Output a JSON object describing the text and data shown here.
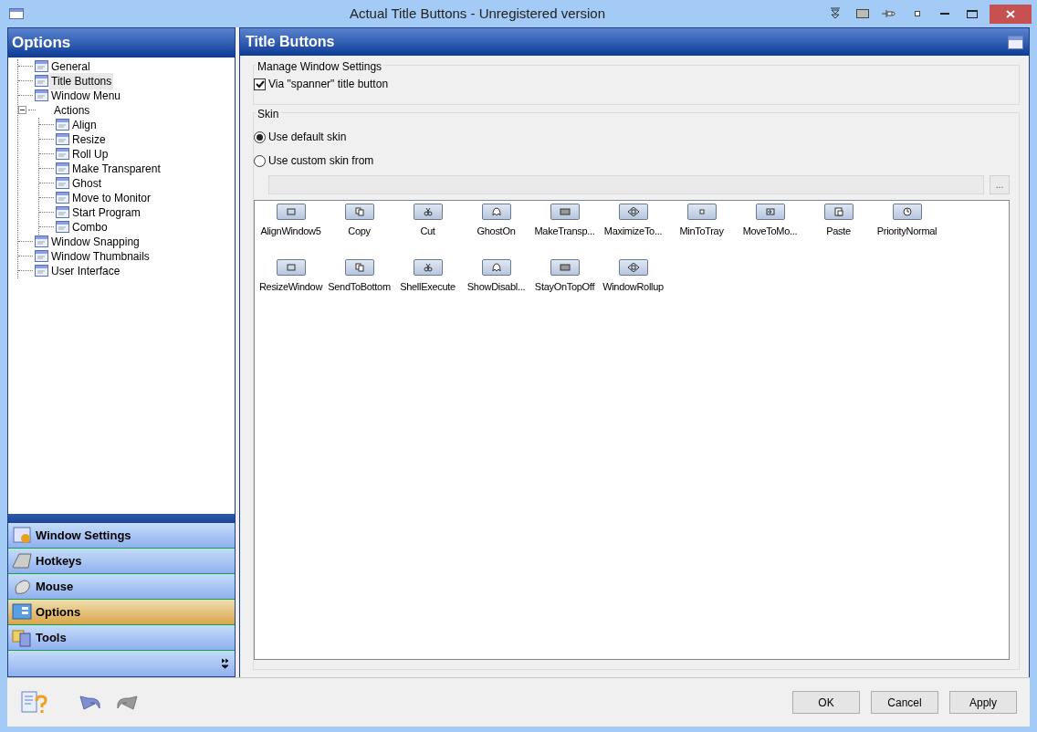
{
  "window": {
    "title": "Actual Title Buttons - Unregistered version"
  },
  "sidebar": {
    "title": "Options",
    "tree": [
      {
        "label": "General",
        "selected": false
      },
      {
        "label": "Title Buttons",
        "selected": true
      },
      {
        "label": "Window Menu",
        "selected": false
      },
      {
        "label": "Actions",
        "selected": false,
        "expanded": true,
        "children": [
          {
            "label": "Align",
            "selected": false
          },
          {
            "label": "Resize",
            "selected": false
          },
          {
            "label": "Roll Up",
            "selected": false
          },
          {
            "label": "Make Transparent",
            "selected": false
          },
          {
            "label": "Ghost",
            "selected": false
          },
          {
            "label": "Move to Monitor",
            "selected": false
          },
          {
            "label": "Start Program",
            "selected": false
          },
          {
            "label": "Combo",
            "selected": false
          }
        ]
      },
      {
        "label": "Window Snapping",
        "selected": false
      },
      {
        "label": "Window Thumbnails",
        "selected": false
      },
      {
        "label": "User Interface",
        "selected": false
      }
    ],
    "nav": [
      {
        "label": "Window Settings",
        "selected": false
      },
      {
        "label": "Hotkeys",
        "selected": false
      },
      {
        "label": "Mouse",
        "selected": false
      },
      {
        "label": "Options",
        "selected": true
      },
      {
        "label": "Tools",
        "selected": false
      }
    ]
  },
  "panel": {
    "title": "Title Buttons",
    "manage_group": {
      "title": "Manage Window Settings",
      "checkbox": {
        "label": "Via \"spanner\" title button",
        "checked": true
      }
    },
    "skin_group": {
      "title": "Skin",
      "radios": [
        {
          "label": "Use default skin",
          "selected": true
        },
        {
          "label": "Use custom skin from",
          "selected": false
        }
      ],
      "browse_button": "...",
      "buttons": [
        {
          "label": "AlignWindow5"
        },
        {
          "label": "Copy"
        },
        {
          "label": "Cut"
        },
        {
          "label": "GhostOn"
        },
        {
          "label": "MakeTransp..."
        },
        {
          "label": "MaximizeTo..."
        },
        {
          "label": "MinToTray"
        },
        {
          "label": "MoveToMo..."
        },
        {
          "label": "Paste"
        },
        {
          "label": "PriorityNormal"
        },
        {
          "label": "ResizeWindow"
        },
        {
          "label": "SendToBottom"
        },
        {
          "label": "ShellExecute"
        },
        {
          "label": "ShowDisabl..."
        },
        {
          "label": "StayOnTopOff"
        },
        {
          "label": "WindowRollup"
        }
      ]
    }
  },
  "footer_buttons": [
    "OK",
    "Cancel",
    "Apply"
  ]
}
